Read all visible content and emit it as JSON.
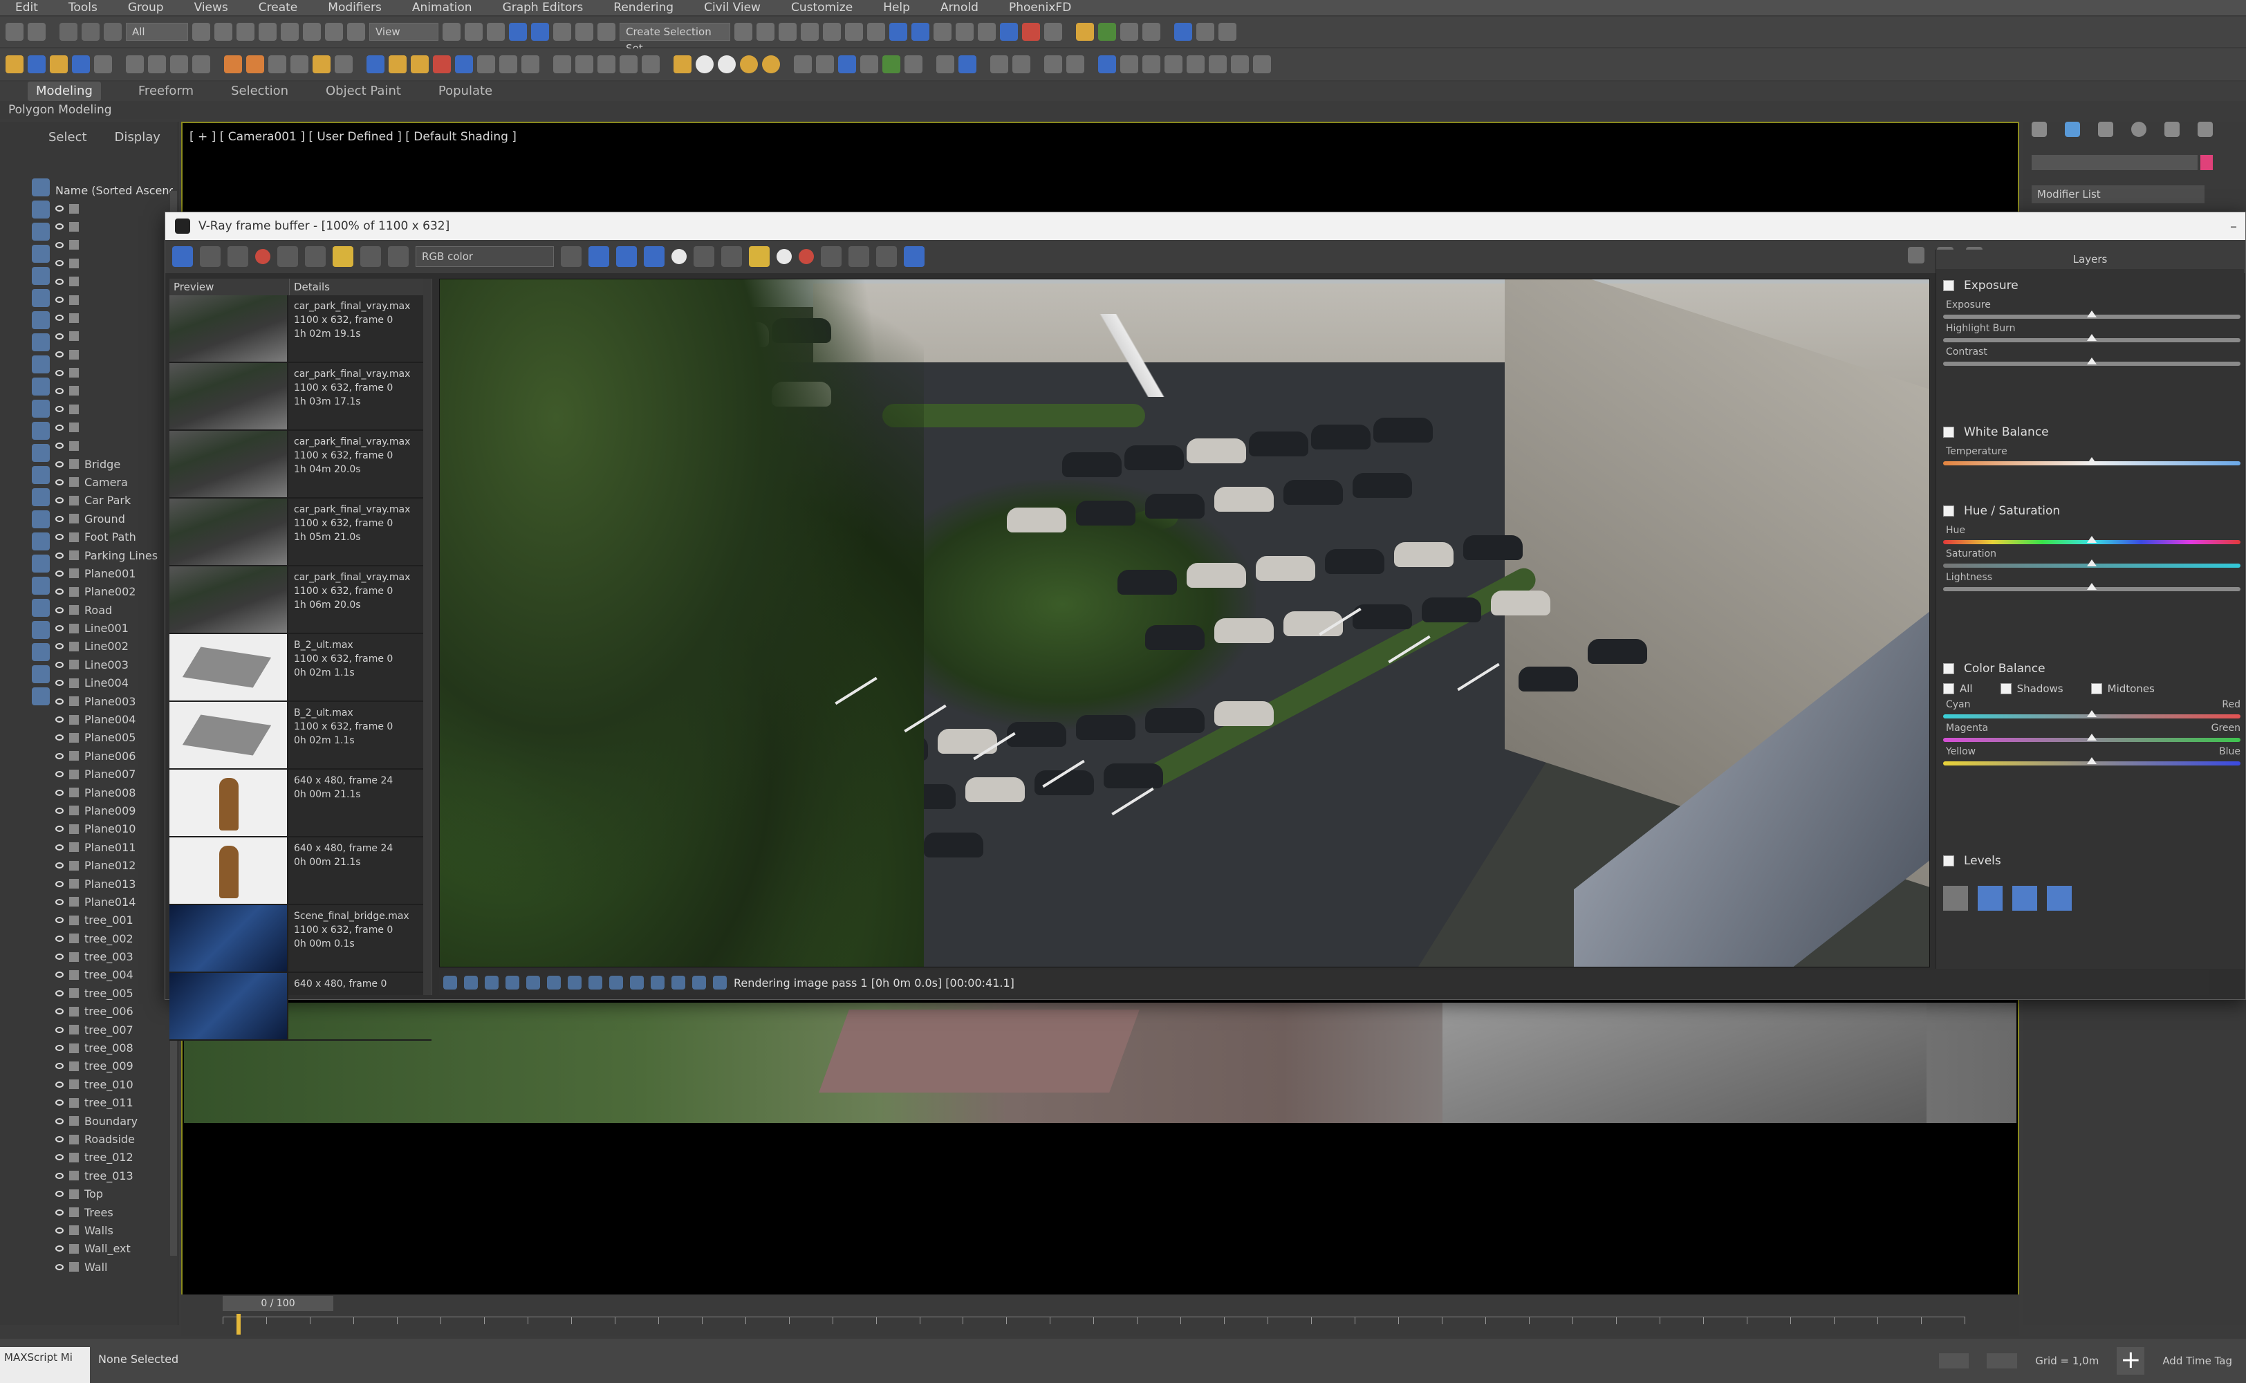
{
  "menubar": [
    "Edit",
    "Tools",
    "Group",
    "Views",
    "Create",
    "Modifiers",
    "Animation",
    "Graph Editors",
    "Rendering",
    "Civil View",
    "Customize",
    "Help",
    "Arnold",
    "PhoenixFD"
  ],
  "toolbar": {
    "selection_filter": "All",
    "view_field": "View",
    "named_selection": "Create Selection Set"
  },
  "ribbon": {
    "tabs": [
      "Modeling",
      "Freeform",
      "Selection",
      "Object Paint",
      "Populate"
    ],
    "active": "Modeling",
    "sub": "Polygon Modeling"
  },
  "scene_explorer": {
    "tabs": [
      "Select",
      "Display"
    ],
    "header": "Name (Sorted Ascending)",
    "rows": [
      "",
      "",
      "",
      "",
      "",
      "",
      "",
      "",
      "",
      "",
      "",
      "",
      "",
      "",
      "Bridge",
      "Camera",
      "Car Park",
      "Ground",
      "Foot Path",
      "Parking Lines",
      "Plane001",
      "Plane002",
      "Road",
      "Line001",
      "Line002",
      "Line003",
      "Line004",
      "Plane003",
      "Plane004",
      "Plane005",
      "Plane006",
      "Plane007",
      "Plane008",
      "Plane009",
      "Plane010",
      "Plane011",
      "Plane012",
      "Plane013",
      "Plane014",
      "tree_001",
      "tree_002",
      "tree_003",
      "tree_004",
      "tree_005",
      "tree_006",
      "tree_007",
      "tree_008",
      "tree_009",
      "tree_010",
      "tree_011",
      "Boundary",
      "Roadside",
      "tree_012",
      "tree_013",
      "Top",
      "Trees",
      "Walls",
      "Wall_ext",
      "Wall"
    ]
  },
  "viewport": {
    "label": "[ + ] [ Camera001 ] [ User Defined ] [ Default Shading ]"
  },
  "command_panel": {
    "dropdown": "Modifier List"
  },
  "vfb": {
    "title": "V-Ray frame buffer - [100% of 1100 x 632]",
    "channel": "RGB color",
    "history_headers": {
      "preview": "Preview",
      "details": "Details"
    },
    "history": [
      {
        "thumb": "park",
        "name": "car_park_final_vray.max",
        "line2": "1100 x 632, frame 0",
        "line3": "1h 02m 19.1s"
      },
      {
        "thumb": "park",
        "name": "car_park_final_vray.max",
        "line2": "1100 x 632, frame 0",
        "line3": "1h 03m 17.1s"
      },
      {
        "thumb": "park",
        "name": "car_park_final_vray.max",
        "line2": "1100 x 632, frame 0",
        "line3": "1h 04m 20.0s"
      },
      {
        "thumb": "park",
        "name": "car_park_final_vray.max",
        "line2": "1100 x 632, frame 0",
        "line3": "1h 05m 21.0s"
      },
      {
        "thumb": "park",
        "name": "car_park_final_vray.max",
        "line2": "1100 x 632, frame 0",
        "line3": "1h 06m 20.0s"
      },
      {
        "thumb": "white",
        "name": "B_2_ult.max",
        "line2": "1100 x 632, frame 0",
        "line3": "0h 02m 1.1s"
      },
      {
        "thumb": "white",
        "name": "B_2_ult.max",
        "line2": "1100 x 632, frame 0",
        "line3": "0h 02m 1.1s"
      },
      {
        "thumb": "statue",
        "name": "640 x 480, frame 24",
        "line2": "0h 00m 21.1s",
        "line3": ""
      },
      {
        "thumb": "statue",
        "name": "640 x 480, frame 24",
        "line2": "0h 00m 21.1s",
        "line3": ""
      },
      {
        "thumb": "blue",
        "name": "Scene_final_bridge.max",
        "line2": "1100 x 632, frame 0",
        "line3": "0h 00m 0.1s"
      },
      {
        "thumb": "blue",
        "name": "640 x 480, frame 0",
        "line2": "",
        "line3": ""
      }
    ],
    "status": "Rendering image pass 1 [0h 0m 0.0s] [00:00:41.1]",
    "corrections": {
      "header": "Layers",
      "exposure": {
        "title": "Exposure",
        "labels": [
          "Exposure",
          "Highlight Burn",
          "Contrast"
        ],
        "values": [
          0.5,
          0.5,
          0.5
        ]
      },
      "white_balance": {
        "title": "White Balance",
        "labels": [
          "Temperature"
        ],
        "values": [
          0.5
        ]
      },
      "hue_sat": {
        "title": "Hue / Saturation",
        "labels": [
          "Hue",
          "Saturation",
          "Lightness"
        ],
        "values": [
          0.5,
          0.5,
          0.5
        ]
      },
      "color_balance": {
        "title": "Color Balance",
        "options": [
          "All",
          "Shadows",
          "Midtones"
        ],
        "labels": [
          "Cyan",
          "Magenta",
          "Yellow"
        ],
        "end_labels": [
          "Red",
          "Green",
          "Blue"
        ],
        "values": [
          0.5,
          0.5,
          0.5
        ]
      },
      "levels": {
        "title": "Levels"
      }
    }
  },
  "timeline": {
    "slider": "0 / 100"
  },
  "status_bar": {
    "listener": "MAXScript Mi",
    "message": "None Selected",
    "grid": "Grid = 1,0m",
    "add_time_tag": "Add Time Tag"
  },
  "colors": {
    "accent_blue": "#3b6bc4",
    "viewport_border": "#8a8a1e",
    "swatch": "#e0417a"
  }
}
